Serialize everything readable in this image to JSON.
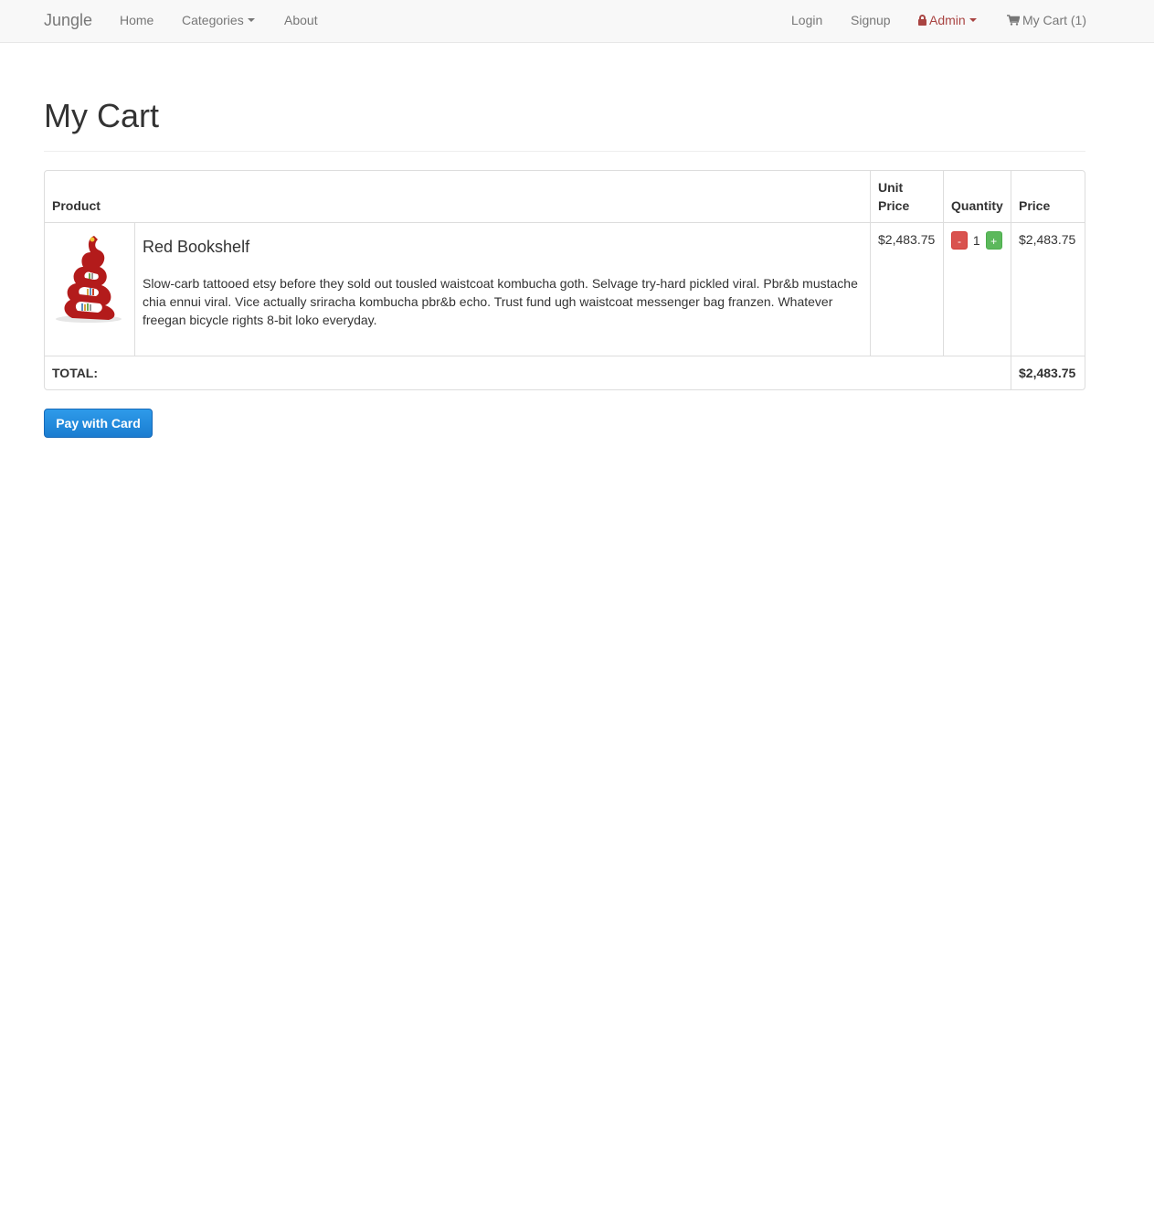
{
  "navbar": {
    "brand": "Jungle",
    "home": "Home",
    "categories": "Categories",
    "about": "About",
    "login": "Login",
    "signup": "Signup",
    "admin": "Admin",
    "cart": "My Cart (1)",
    "icons": {
      "admin": "lock-icon",
      "cart": "shopping-cart-icon"
    },
    "admin_color": "#a94442"
  },
  "page": {
    "title": "My Cart"
  },
  "table": {
    "headers": {
      "product": "Product",
      "unit_price": "Unit Price",
      "quantity": "Quantity",
      "price": "Price"
    },
    "items": [
      {
        "name": "Red Bookshelf",
        "description": "Slow-carb tattooed etsy before they sold out tousled waistcoat kombucha goth. Selvage try-hard pickled viral. Pbr&b mustache chia ennui viral. Vice actually sriracha kombucha pbr&b echo. Trust fund ugh waistcoat messenger bag franzen. Whatever freegan bicycle rights 8-bit loko everyday.",
        "unit_price": "$2,483.75",
        "quantity": "1",
        "price": "$2,483.75",
        "decrement_label": "-",
        "increment_label": "+"
      }
    ],
    "total_label": "TOTAL:",
    "total_value": "$2,483.75"
  },
  "actions": {
    "pay_label": "Pay with Card"
  }
}
